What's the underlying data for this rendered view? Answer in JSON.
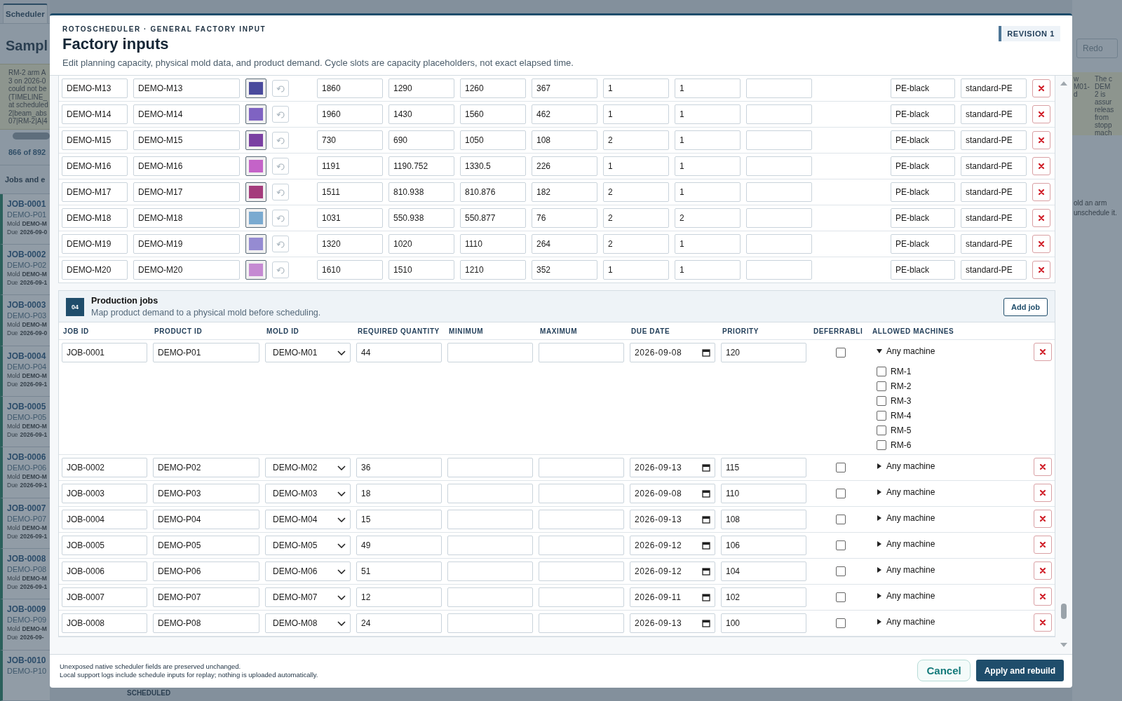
{
  "background": {
    "tabs": [
      {
        "label": "Scheduler",
        "selected": true
      }
    ],
    "title": "Sampl",
    "notice_lines": [
      "RM-2 arm A",
      "3 on 2026-0",
      "could not be",
      "(TIMELINE_",
      "at scheduled",
      "2|beam_abs",
      "07|RM-2|A|4"
    ],
    "count": "866 of 892",
    "jobs_heading": "Jobs and e",
    "jobs": [
      {
        "id": "JOB-0001",
        "product": "DEMO-P01",
        "mold_label": "Mold",
        "mold": "DEMO-M",
        "due_label": "Due",
        "due": "2026-09-0"
      },
      {
        "id": "JOB-0002",
        "product": "DEMO-P02",
        "mold_label": "Mold",
        "mold": "DEMO-M",
        "due_label": "Due",
        "due": "2026-09-1"
      },
      {
        "id": "JOB-0003",
        "product": "DEMO-P03",
        "mold_label": "Mold",
        "mold": "DEMO-M",
        "due_label": "Due",
        "due": "2026-09-0"
      },
      {
        "id": "JOB-0004",
        "product": "DEMO-P04",
        "mold_label": "Mold",
        "mold": "DEMO-M",
        "due_label": "Due",
        "due": "2026-09-1"
      },
      {
        "id": "JOB-0005",
        "product": "DEMO-P05",
        "mold_label": "Mold",
        "mold": "DEMO-M",
        "due_label": "Due",
        "due": "2026-09-1"
      },
      {
        "id": "JOB-0006",
        "product": "DEMO-P06",
        "mold_label": "Mold",
        "mold": "DEMO-M",
        "due_label": "Due",
        "due": "2026-09-1"
      },
      {
        "id": "JOB-0007",
        "product": "DEMO-P07",
        "mold_label": "Mold",
        "mold": "DEMO-M",
        "due_label": "Due",
        "due": "2026-09-1"
      },
      {
        "id": "JOB-0008",
        "product": "DEMO-P08",
        "mold_label": "Mold",
        "mold": "DEMO-M",
        "due_label": "Due",
        "due": "2026-09-1"
      },
      {
        "id": "JOB-0009",
        "product": "DEMO-P09",
        "mold_label": "Mold",
        "mold": "DEMO-M",
        "due_label": "Due",
        "due": "2026-09-"
      },
      {
        "id": "JOB-0010",
        "product": "DEMO-P10"
      }
    ],
    "status": "SCHEDULED",
    "redo": "Redo",
    "notice_column_1": [
      "w",
      "M01-",
      "d"
    ],
    "notice_column_2": [
      "The c",
      "DEM",
      "2 is",
      "assur",
      "releas",
      "from",
      "stopp",
      "mach"
    ],
    "hint_lines": [
      "old an arm",
      "unschedule it."
    ]
  },
  "dialog": {
    "eyebrow": "ROTOSCHEDULER · GENERAL FACTORY INPUT",
    "title": "Factory inputs",
    "description": "Edit planning capacity, physical mold data, and product demand. Cycle slots are capacity placeholders, not exact elapsed time.",
    "revision": "REVISION 1",
    "molds": [
      {
        "column_1": "DEMO-M13",
        "column_2": "DEMO-M13",
        "color": "#4a4a9c",
        "numbers": [
          "1860",
          "1290",
          "1260",
          "367",
          "1",
          "1"
        ],
        "column_11": "PE-black",
        "column_12": "standard-PE"
      },
      {
        "column_1": "DEMO-M14",
        "column_2": "DEMO-M14",
        "color": "#7f63c2",
        "numbers": [
          "1960",
          "1430",
          "1560",
          "462",
          "1",
          "1"
        ],
        "column_11": "PE-black",
        "column_12": "standard-PE"
      },
      {
        "column_1": "DEMO-M15",
        "column_2": "DEMO-M15",
        "color": "#7a40a2",
        "numbers": [
          "730",
          "690",
          "1050",
          "108",
          "2",
          "1"
        ],
        "column_11": "PE-black",
        "column_12": "standard-PE"
      },
      {
        "column_1": "DEMO-M16",
        "column_2": "DEMO-M16",
        "color": "#c463c8",
        "numbers": [
          "1191",
          "1190.752",
          "1330.5",
          "226",
          "1",
          "1"
        ],
        "column_11": "PE-black",
        "column_12": "standard-PE"
      },
      {
        "column_1": "DEMO-M17",
        "column_2": "DEMO-M17",
        "color": "#a43c7c",
        "numbers": [
          "1511",
          "810.938",
          "810.876",
          "182",
          "2",
          "1"
        ],
        "column_11": "PE-black",
        "column_12": "standard-PE"
      },
      {
        "column_1": "DEMO-M18",
        "column_2": "DEMO-M18",
        "color": "#7aaad0",
        "numbers": [
          "1031",
          "550.938",
          "550.877",
          "76",
          "2",
          "2"
        ],
        "column_11": "PE-black",
        "column_12": "standard-PE"
      },
      {
        "column_1": "DEMO-M19",
        "column_2": "DEMO-M19",
        "color": "#958bd2",
        "numbers": [
          "1320",
          "1020",
          "1110",
          "264",
          "2",
          "1"
        ],
        "column_11": "PE-black",
        "column_12": "standard-PE"
      },
      {
        "column_1": "DEMO-M20",
        "column_2": "DEMO-M20",
        "color": "#c58ad2",
        "numbers": [
          "1610",
          "1510",
          "1210",
          "352",
          "1",
          "1"
        ],
        "column_11": "PE-black",
        "column_12": "standard-PE"
      }
    ],
    "jobs_section": {
      "number": "04",
      "title": "Production jobs",
      "subtitle": "Map product demand to a physical mold before scheduling.",
      "add_button": "Add job",
      "columns": [
        "JOB ID",
        "PRODUCT ID",
        "MOLD ID",
        "REQUIRED QUANTITY",
        "MINIMUM",
        "MAXIMUM",
        "DUE DATE",
        "PRIORITY",
        "DEFERRABLI",
        "ALLOWED MACHINES"
      ],
      "rows": [
        {
          "job_id": "JOB-0001",
          "product_id": "DEMO-P01",
          "mold_id": "DEMO-M01",
          "required_quantity": "44",
          "due_date": "2026-09-08",
          "priority": "120",
          "deferrable": false,
          "machines_label": "Any machine",
          "expanded": true,
          "machines": [
            {
              "label": "RM-1",
              "checked": false
            },
            {
              "label": "RM-2",
              "checked": false
            },
            {
              "label": "RM-3",
              "checked": false
            },
            {
              "label": "RM-4",
              "checked": false
            },
            {
              "label": "RM-5",
              "checked": false
            },
            {
              "label": "RM-6",
              "checked": false
            }
          ]
        },
        {
          "job_id": "JOB-0002",
          "product_id": "DEMO-P02",
          "mold_id": "DEMO-M02",
          "required_quantity": "36",
          "due_date": "2026-09-13",
          "priority": "115",
          "deferrable": false,
          "machines_label": "Any machine",
          "expanded": false
        },
        {
          "job_id": "JOB-0003",
          "product_id": "DEMO-P03",
          "mold_id": "DEMO-M03",
          "required_quantity": "18",
          "due_date": "2026-09-08",
          "priority": "110",
          "deferrable": false,
          "machines_label": "Any machine",
          "expanded": false
        },
        {
          "job_id": "JOB-0004",
          "product_id": "DEMO-P04",
          "mold_id": "DEMO-M04",
          "required_quantity": "15",
          "due_date": "2026-09-13",
          "priority": "108",
          "deferrable": false,
          "machines_label": "Any machine",
          "expanded": false
        },
        {
          "job_id": "JOB-0005",
          "product_id": "DEMO-P05",
          "mold_id": "DEMO-M05",
          "required_quantity": "49",
          "due_date": "2026-09-12",
          "priority": "106",
          "deferrable": false,
          "machines_label": "Any machine",
          "expanded": false
        },
        {
          "job_id": "JOB-0006",
          "product_id": "DEMO-P06",
          "mold_id": "DEMO-M06",
          "required_quantity": "51",
          "due_date": "2026-09-12",
          "priority": "104",
          "deferrable": false,
          "machines_label": "Any machine",
          "expanded": false
        },
        {
          "job_id": "JOB-0007",
          "product_id": "DEMO-P07",
          "mold_id": "DEMO-M07",
          "required_quantity": "12",
          "due_date": "2026-09-11",
          "priority": "102",
          "deferrable": false,
          "machines_label": "Any machine",
          "expanded": false
        },
        {
          "job_id": "JOB-0008",
          "product_id": "DEMO-P08",
          "mold_id": "DEMO-M08",
          "required_quantity": "24",
          "due_date": "2026-09-13",
          "priority": "100",
          "deferrable": false,
          "machines_label": "Any machine",
          "expanded": false
        }
      ]
    },
    "footer_notes": [
      "Unexposed native scheduler fields are preserved unchanged.",
      "Local support logs include schedule inputs for replay; nothing is uploaded automatically."
    ],
    "cancel": "Cancel",
    "apply": "Apply and rebuild"
  }
}
